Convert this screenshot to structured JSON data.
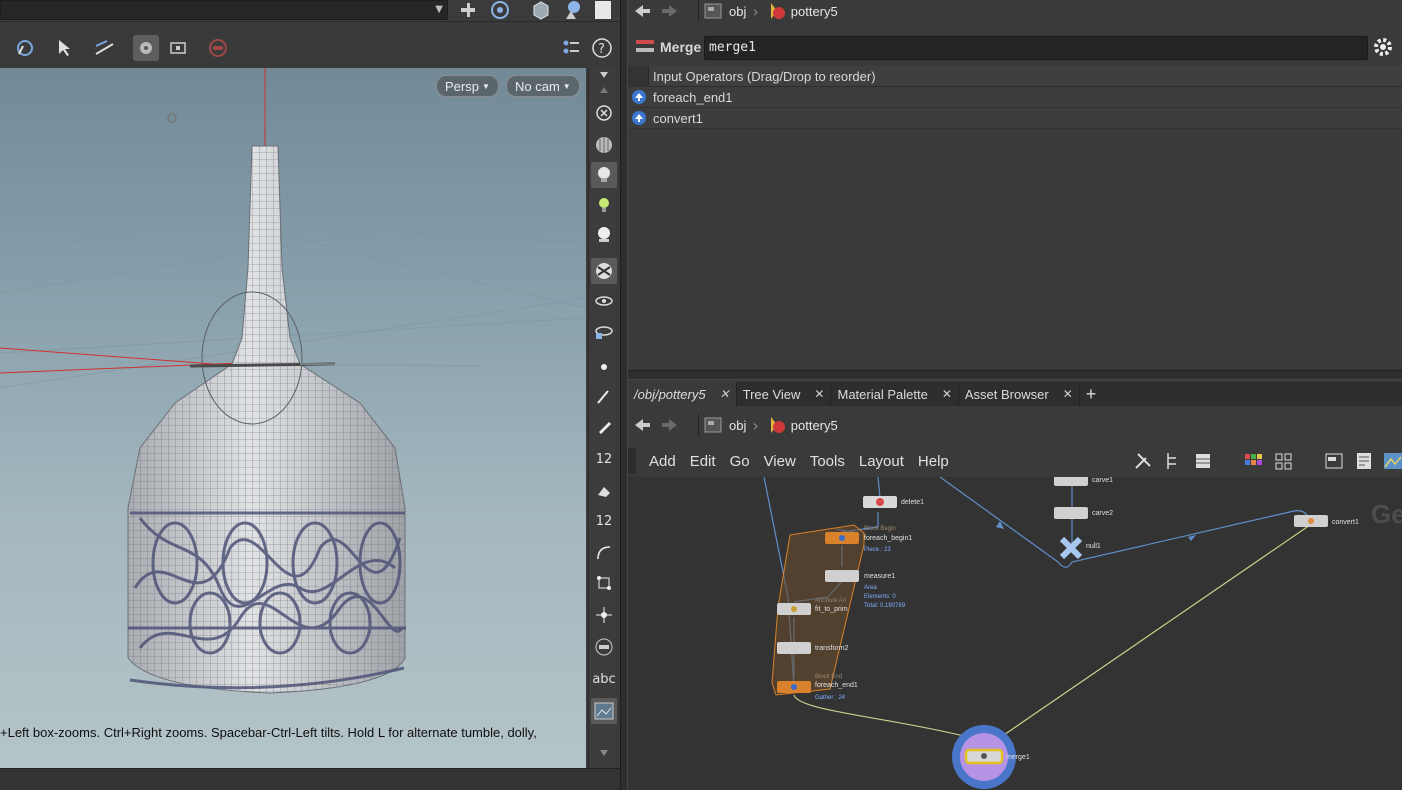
{
  "viewport": {
    "persp_label": "Persp",
    "cam_label": "No cam",
    "hint": "+Left box-zooms. Ctrl+Right zooms. Spacebar-Ctrl-Left tilts. Hold L for alternate tumble, dolly,"
  },
  "right_toolbar": {
    "snap_12_a": "12",
    "snap_12_b": "12",
    "abc": "abc"
  },
  "top_nav": {
    "crumb_obj": "obj",
    "crumb_geo": "pottery5"
  },
  "parm": {
    "node_type": "Merge",
    "node_name": "merge1",
    "inputs_header": "Input Operators (Drag/Drop to reorder)",
    "inputs": [
      "foreach_end1",
      "convert1"
    ]
  },
  "tabs": [
    {
      "label": "/obj/pottery5",
      "active": true
    },
    {
      "label": "Tree View",
      "active": false
    },
    {
      "label": "Material Palette",
      "active": false
    },
    {
      "label": "Asset Browser",
      "active": false
    }
  ],
  "net_nav": {
    "crumb_obj": "obj",
    "crumb_geo": "pottery5"
  },
  "menus": [
    "Add",
    "Edit",
    "Go",
    "View",
    "Tools",
    "Layout",
    "Help"
  ],
  "network": {
    "watermark": "Ge",
    "nodes": {
      "delete1": "delete1",
      "carve1": "carve1",
      "carve2": "carve2",
      "null1": "null1",
      "convert1": "convert1",
      "block_begin": "Block Begin",
      "foreach_begin1": "foreach_begin1",
      "piece": "Piece : 23",
      "measure1": "measure1",
      "area": "Area",
      "elements": "Elements: 0",
      "total": "Total: 0.190789",
      "attr": "Attribute Ari",
      "fit_to_prim": "fit_to_prim",
      "transform2": "transform2",
      "block_end": "Block End",
      "foreach_end1": "foreach_end1",
      "gather": "Gather : 24",
      "merge1": "merge1"
    }
  },
  "colors": {
    "accent_orange": "#d9822b",
    "wire_blue": "#5e8fc8",
    "wire_yellow": "#c8d08a",
    "merge_ring": "#4a76c9"
  }
}
